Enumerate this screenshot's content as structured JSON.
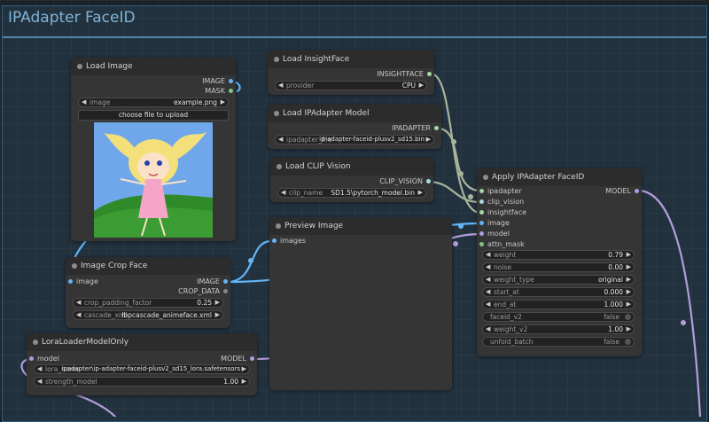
{
  "group": {
    "title": "IPAdapter FaceID"
  },
  "colors": {
    "image": "#64b5f6",
    "mask": "#81c784",
    "insightface": "#a5d6a7",
    "ipadapter": "#a5d6a7",
    "clip_vision": "#a8dadc",
    "model": "#b39ddb",
    "link": "#a8b49a"
  },
  "load_image": {
    "title": "Load Image",
    "outputs": [
      "IMAGE",
      "MASK"
    ],
    "image_label": "image",
    "image_value": "example.png",
    "upload_label": "choose file to upload"
  },
  "load_insightface": {
    "title": "Load InsightFace",
    "output": "INSIGHTFACE",
    "provider_label": "provider",
    "provider_value": "CPU"
  },
  "load_ipadapter": {
    "title": "Load IPAdapter Model",
    "output": "IPADAPTER",
    "file_label": "ipadapter_file",
    "file_value": "ip-adapter-faceid-plusv2_sd15.bin"
  },
  "load_clip_vision": {
    "title": "Load CLIP Vision",
    "output": "CLIP_VISION",
    "clip_label": "clip_name",
    "clip_value": "SD1.5\\pytorch_model.bin"
  },
  "preview_image": {
    "title": "Preview Image",
    "input": "images"
  },
  "apply_ipadapter": {
    "title": "Apply IPAdapter FaceID",
    "output": "MODEL",
    "inputs": [
      "ipadapter",
      "clip_vision",
      "insightface",
      "image",
      "model",
      "attn_mask"
    ],
    "widgets": [
      {
        "label": "weight",
        "value": "0.79"
      },
      {
        "label": "noise",
        "value": "0.00"
      },
      {
        "label": "weight_type",
        "value": "original"
      },
      {
        "label": "start_at",
        "value": "0.000"
      },
      {
        "label": "end_at",
        "value": "1.000"
      },
      {
        "label": "faceid_v2",
        "value": "false"
      },
      {
        "label": "weight_v2",
        "value": "1.00"
      },
      {
        "label": "unfold_batch",
        "value": "false"
      }
    ]
  },
  "crop_face": {
    "title": "Image Crop Face",
    "input": "image",
    "outputs": [
      "IMAGE",
      "CROP_DATA"
    ],
    "padding_label": "crop_padding_factor",
    "padding_value": "0.25",
    "cascade_label": "cascade_xml",
    "cascade_value": "lbpcascade_animeface.xml"
  },
  "lora_loader": {
    "title": "LoraLoaderModelOnly",
    "input": "model",
    "output": "MODEL",
    "lora_label": "lora_name",
    "lora_value": "ipadapter\\ip-adapter-faceid-plusv2_sd15_lora.safetensors",
    "strength_label": "strength_model",
    "strength_value": "1.00"
  }
}
